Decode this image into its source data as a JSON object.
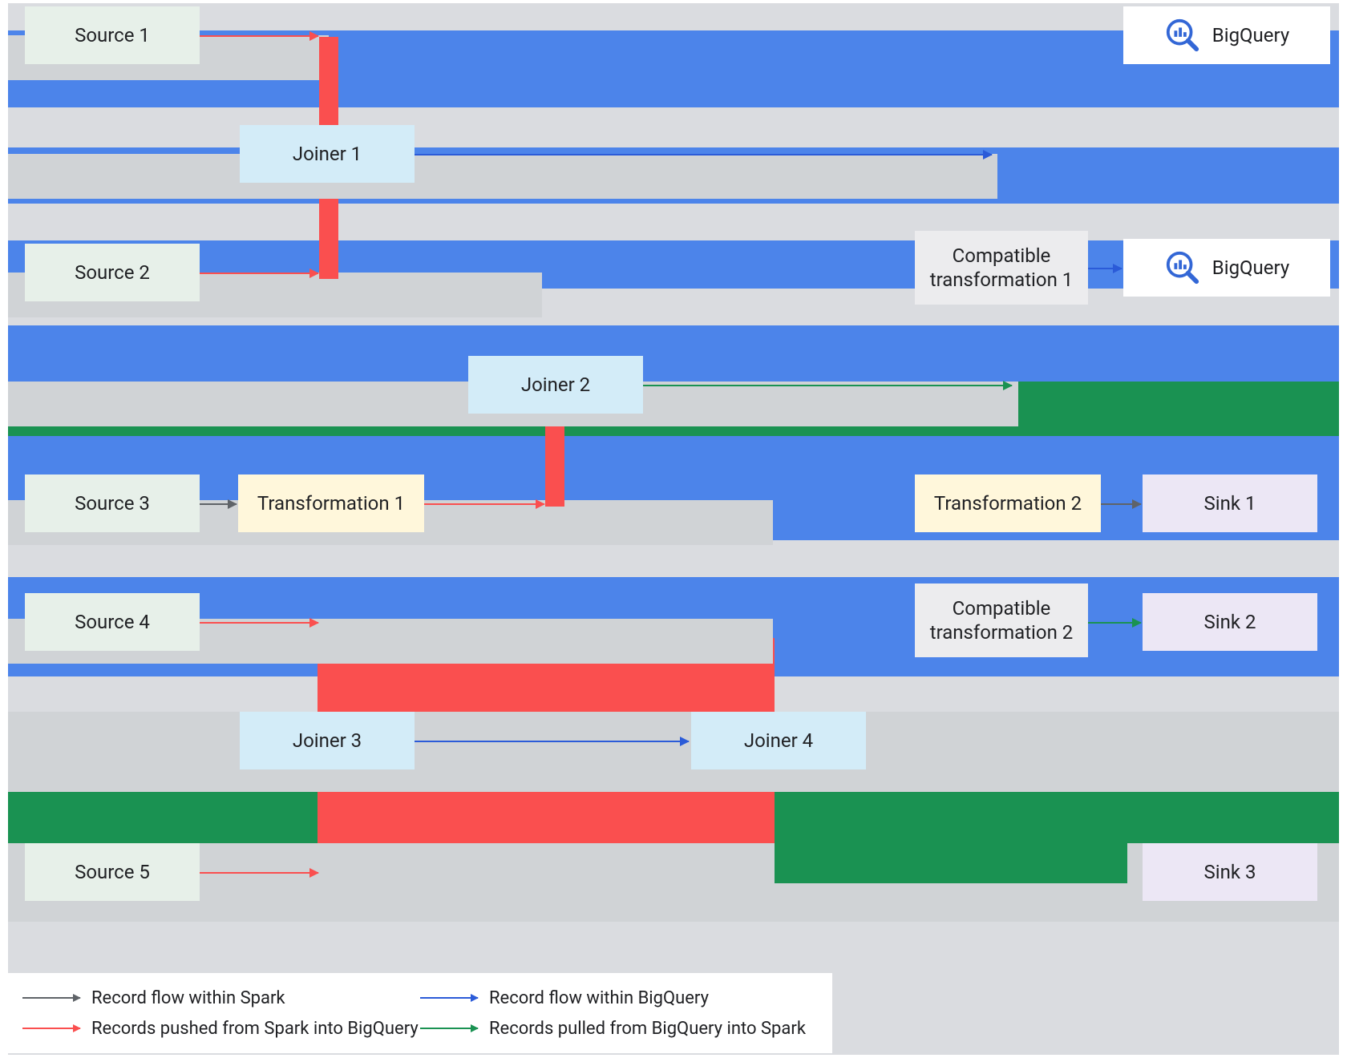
{
  "colors": {
    "blue": "#4c84ea",
    "green": "#1a9252",
    "red": "#fa4f4f",
    "gray": "#dadce0",
    "source": "#e7f0e9",
    "joiner": "#d3ecf8",
    "trans": "#fff7db",
    "compat": "#ececee",
    "sink": "#ece7f5"
  },
  "nodes": {
    "source1": "Source 1",
    "source2": "Source 2",
    "source3": "Source 3",
    "source4": "Source 4",
    "source5": "Source 5",
    "joiner1": "Joiner 1",
    "joiner2": "Joiner 2",
    "joiner3": "Joiner 3",
    "joiner4": "Joiner 4",
    "trans1": "Transformation 1",
    "trans2": "Transformation 2",
    "compat1": "Compatible\ntransformation 1",
    "compat2": "Compatible\ntransformation 2",
    "sink1": "Sink 1",
    "sink2": "Sink 2",
    "sink3": "Sink 3",
    "bigquery": "BigQuery"
  },
  "legend": {
    "within_spark": "Record flow within Spark",
    "within_bq": "Record flow within BigQuery",
    "push": "Records pushed from Spark into BigQuery",
    "pull": "Records pulled from BigQuery into Spark"
  }
}
